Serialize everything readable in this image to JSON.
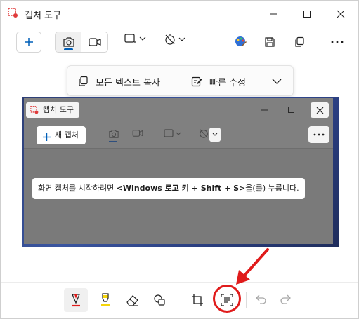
{
  "window": {
    "title": "캡처 도구"
  },
  "action_bar": {
    "copy_all_text": "모든 텍스트 복사",
    "quick_edit": "빠른 수정"
  },
  "inner_app": {
    "title": "캡처 도구",
    "new_capture": "새 캡처",
    "message_prefix": "화면 캡처를 시작하려면 ",
    "message_key": "<Windows 로고 키 + Shift + S>",
    "message_suffix": "을(를) 누릅니다."
  },
  "icons": {
    "app": "snipping-tool-icon",
    "minimize": "minimize-icon",
    "maximize": "maximize-icon",
    "close": "close-icon",
    "new": "plus-icon",
    "camera": "camera-icon",
    "video": "video-icon",
    "shape": "rectangle-mode-icon",
    "delay": "timer-off-icon",
    "edit_paint": "paint-icon",
    "save": "save-icon",
    "copy": "copy-icon",
    "more": "more-icon",
    "pen": "ballpoint-pen-icon",
    "highlighter": "highlighter-icon",
    "eraser": "eraser-icon",
    "shapes": "shapes-icon",
    "crop": "crop-icon",
    "text_actions": "text-actions-icon",
    "undo": "undo-icon",
    "redo": "redo-icon"
  },
  "colors": {
    "accent": "#005fb8",
    "annotation": "#e01b1b",
    "highlighter": "#f5d50a"
  }
}
